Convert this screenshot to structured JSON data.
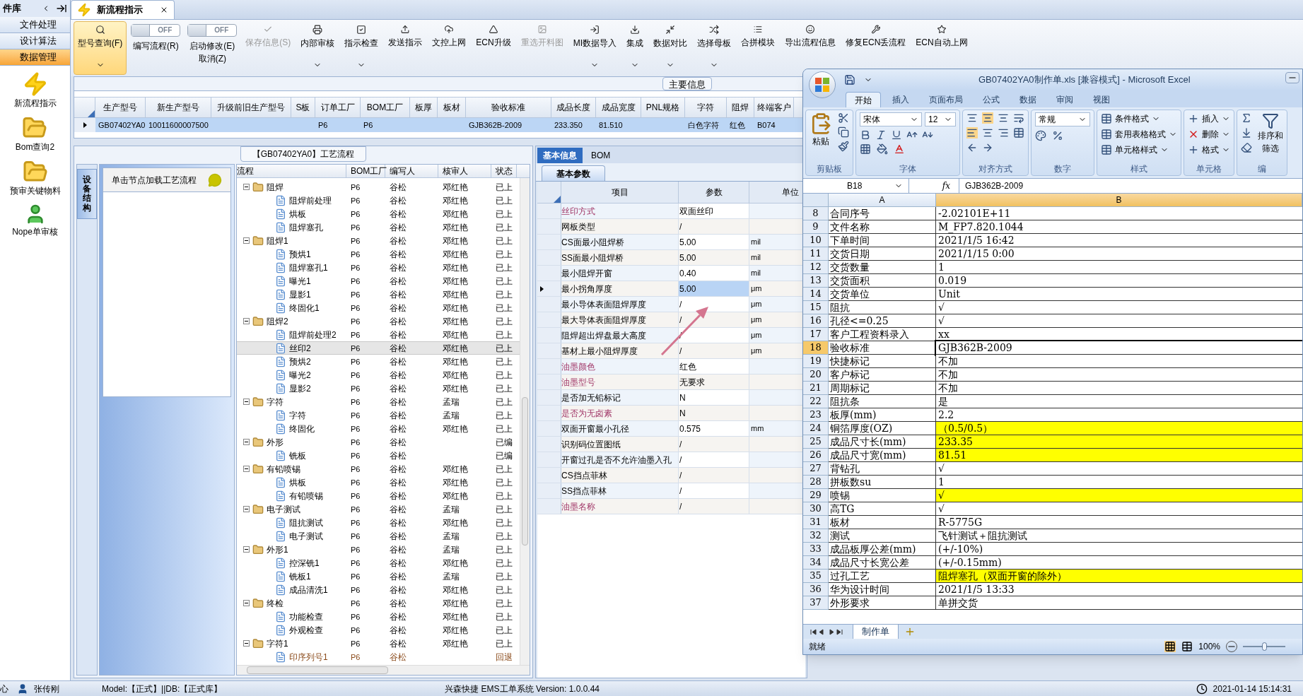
{
  "sidebar": {
    "title": "件库",
    "menu": [
      {
        "label": "文件处理",
        "selected": false
      },
      {
        "label": "设计算法",
        "selected": false
      },
      {
        "label": "数据管理",
        "selected": true
      }
    ],
    "shortcuts": [
      {
        "label": "新流程指示",
        "kind": "bolt"
      },
      {
        "label": "Bom查询2",
        "kind": "folder"
      },
      {
        "label": "预审关键物料",
        "kind": "folder"
      },
      {
        "label": "Nope单审核",
        "kind": "person"
      }
    ]
  },
  "tabs": [
    {
      "label": "新流程指示",
      "selected": true
    }
  ],
  "toolbar": [
    {
      "kind": "button",
      "label": "型号查询(F)",
      "selected": true,
      "disabled": false,
      "dropdown": true
    },
    {
      "kind": "toggle",
      "label": "编写流程(R)",
      "state_text": "OFF",
      "on": false
    },
    {
      "kind": "toggle",
      "label": "启动修改(E)",
      "label2": "取消(Z)",
      "state_text": "OFF",
      "on": false
    },
    {
      "kind": "button",
      "label": "保存信息(S)",
      "selected": false,
      "disabled": true,
      "dropdown": false
    },
    {
      "kind": "button",
      "label": "内部审核",
      "selected": false,
      "disabled": false,
      "dropdown": true
    },
    {
      "kind": "button",
      "label": "指示检查",
      "selected": false,
      "disabled": false,
      "dropdown": true
    },
    {
      "kind": "button",
      "label": "发送指示",
      "selected": false,
      "disabled": false,
      "dropdown": false
    },
    {
      "kind": "button",
      "label": "文控上网",
      "selected": false,
      "disabled": false,
      "dropdown": false
    },
    {
      "kind": "button",
      "label": "ECN升级",
      "selected": false,
      "disabled": false,
      "dropdown": false
    },
    {
      "kind": "button",
      "label": "重选开料图",
      "selected": false,
      "disabled": true,
      "dropdown": false
    },
    {
      "kind": "button",
      "label": "MI数据导入",
      "selected": false,
      "disabled": false,
      "dropdown": true
    },
    {
      "kind": "button",
      "label": "集成",
      "selected": false,
      "disabled": false,
      "dropdown": true
    },
    {
      "kind": "button",
      "label": "数据对比",
      "selected": false,
      "disabled": false,
      "dropdown": true
    },
    {
      "kind": "button",
      "label": "选择母板",
      "selected": false,
      "disabled": false,
      "dropdown": true
    },
    {
      "kind": "button",
      "label": "合拼模块",
      "selected": false,
      "disabled": false,
      "dropdown": false
    },
    {
      "kind": "button",
      "label": "导出流程信息",
      "selected": false,
      "disabled": false,
      "dropdown": false
    },
    {
      "kind": "button",
      "label": "修复ECN丢流程",
      "selected": false,
      "disabled": false,
      "dropdown": false
    },
    {
      "kind": "button",
      "label": "ECN自动上网",
      "selected": false,
      "disabled": false,
      "dropdown": false
    }
  ],
  "main_info": {
    "title": "主要信息",
    "columns": [
      "生产型号",
      "新生产型号",
      "升级前旧生产型号",
      "S板",
      "订单工厂",
      "BOM工厂",
      "板厚",
      "板材",
      "验收标准",
      "成品长度",
      "成品宽度",
      "PNL规格",
      "字符",
      "阻焊",
      "终端客户"
    ],
    "rows": [
      {
        "selected": true,
        "cells": [
          "GB07402YA0",
          "10011600007500",
          "",
          "",
          "P6",
          "P6",
          "",
          "",
          "GJB362B-2009",
          "233.350",
          "81.510",
          "",
          "白色字符",
          "红色",
          "B074"
        ]
      }
    ]
  },
  "process": {
    "title": "【GB07402YA0】工艺流程",
    "side_tab": "设备结构",
    "hint": "单击节点加载工艺流程",
    "columns": [
      "流程",
      "BOM工厂",
      "编写人",
      "核审人",
      "状态"
    ],
    "rows": [
      {
        "name": "阻焊",
        "bom": "P6",
        "writer": "谷松",
        "reviewer": "邓红艳",
        "status": "已上",
        "expanded": true,
        "selected": false,
        "returned": false,
        "children": [
          {
            "name": "阻焊前处理",
            "bom": "P6",
            "writer": "谷松",
            "reviewer": "邓红艳",
            "status": "已上",
            "selected": false,
            "returned": false
          },
          {
            "name": "烘板",
            "bom": "P6",
            "writer": "谷松",
            "reviewer": "邓红艳",
            "status": "已上",
            "selected": false,
            "returned": false
          },
          {
            "name": "阻焊塞孔",
            "bom": "P6",
            "writer": "谷松",
            "reviewer": "邓红艳",
            "status": "已上",
            "selected": false,
            "returned": false
          }
        ]
      },
      {
        "name": "阻焊1",
        "bom": "P6",
        "writer": "谷松",
        "reviewer": "邓红艳",
        "status": "已上",
        "expanded": true,
        "selected": false,
        "returned": false,
        "children": [
          {
            "name": "预烘1",
            "bom": "P6",
            "writer": "谷松",
            "reviewer": "邓红艳",
            "status": "已上",
            "selected": false,
            "returned": false
          },
          {
            "name": "阻焊塞孔1",
            "bom": "P6",
            "writer": "谷松",
            "reviewer": "邓红艳",
            "status": "已上",
            "selected": false,
            "returned": false
          },
          {
            "name": "曝光1",
            "bom": "P6",
            "writer": "谷松",
            "reviewer": "邓红艳",
            "status": "已上",
            "selected": false,
            "returned": false
          },
          {
            "name": "显影1",
            "bom": "P6",
            "writer": "谷松",
            "reviewer": "邓红艳",
            "status": "已上",
            "selected": false,
            "returned": false
          },
          {
            "name": "终固化1",
            "bom": "P6",
            "writer": "谷松",
            "reviewer": "邓红艳",
            "status": "已上",
            "selected": false,
            "returned": false
          }
        ]
      },
      {
        "name": "阻焊2",
        "bom": "P6",
        "writer": "谷松",
        "reviewer": "邓红艳",
        "status": "已上",
        "expanded": true,
        "selected": false,
        "returned": false,
        "children": [
          {
            "name": "阻焊前处理2",
            "bom": "P6",
            "writer": "谷松",
            "reviewer": "邓红艳",
            "status": "已上",
            "selected": false,
            "returned": false
          },
          {
            "name": "丝印2",
            "bom": "P6",
            "writer": "谷松",
            "reviewer": "邓红艳",
            "status": "已上",
            "selected": true,
            "returned": false
          },
          {
            "name": "预烘2",
            "bom": "P6",
            "writer": "谷松",
            "reviewer": "邓红艳",
            "status": "已上",
            "selected": false,
            "returned": false
          },
          {
            "name": "曝光2",
            "bom": "P6",
            "writer": "谷松",
            "reviewer": "邓红艳",
            "status": "已上",
            "selected": false,
            "returned": false
          },
          {
            "name": "显影2",
            "bom": "P6",
            "writer": "谷松",
            "reviewer": "邓红艳",
            "status": "已上",
            "selected": false,
            "returned": false
          }
        ]
      },
      {
        "name": "字符",
        "bom": "P6",
        "writer": "谷松",
        "reviewer": "孟瑞",
        "status": "已上",
        "expanded": true,
        "selected": false,
        "returned": false,
        "children": [
          {
            "name": "字符",
            "bom": "P6",
            "writer": "谷松",
            "reviewer": "孟瑞",
            "status": "已上",
            "selected": false,
            "returned": false
          },
          {
            "name": "终固化",
            "bom": "P6",
            "writer": "谷松",
            "reviewer": "邓红艳",
            "status": "已上",
            "selected": false,
            "returned": false
          }
        ]
      },
      {
        "name": "外形",
        "bom": "P6",
        "writer": "谷松",
        "status": "已编",
        "expanded": true,
        "selected": false,
        "returned": false,
        "children": [
          {
            "name": "铣板",
            "bom": "P6",
            "writer": "谷松",
            "status": "已编",
            "selected": false,
            "returned": false
          }
        ]
      },
      {
        "name": "有铅喷锡",
        "bom": "P6",
        "writer": "谷松",
        "reviewer": "邓红艳",
        "status": "已上",
        "expanded": true,
        "selected": false,
        "returned": false,
        "children": [
          {
            "name": "烘板",
            "bom": "P6",
            "writer": "谷松",
            "reviewer": "邓红艳",
            "status": "已上",
            "selected": false,
            "returned": false
          },
          {
            "name": "有铅喷锡",
            "bom": "P6",
            "writer": "谷松",
            "reviewer": "邓红艳",
            "status": "已上",
            "selected": false,
            "returned": false
          }
        ]
      },
      {
        "name": "电子测试",
        "bom": "P6",
        "writer": "谷松",
        "reviewer": "孟瑞",
        "status": "已上",
        "expanded": true,
        "selected": false,
        "returned": false,
        "children": [
          {
            "name": "阻抗测试",
            "bom": "P6",
            "writer": "谷松",
            "reviewer": "邓红艳",
            "status": "已上",
            "selected": false,
            "returned": false
          },
          {
            "name": "电子测试",
            "bom": "P6",
            "writer": "谷松",
            "reviewer": "孟瑞",
            "status": "已上",
            "selected": false,
            "returned": false
          }
        ]
      },
      {
        "name": "外形1",
        "bom": "P6",
        "writer": "谷松",
        "reviewer": "孟瑞",
        "status": "已上",
        "expanded": true,
        "selected": false,
        "returned": false,
        "children": [
          {
            "name": "控深铣1",
            "bom": "P6",
            "writer": "谷松",
            "reviewer": "邓红艳",
            "status": "已上",
            "selected": false,
            "returned": false
          },
          {
            "name": "铣板1",
            "bom": "P6",
            "writer": "谷松",
            "reviewer": "孟瑞",
            "status": "已上",
            "selected": false,
            "returned": false
          },
          {
            "name": "成品清洗1",
            "bom": "P6",
            "writer": "谷松",
            "reviewer": "邓红艳",
            "status": "已上",
            "selected": false,
            "returned": false
          }
        ]
      },
      {
        "name": "终检",
        "bom": "P6",
        "writer": "谷松",
        "reviewer": "邓红艳",
        "status": "已上",
        "expanded": true,
        "selected": false,
        "returned": false,
        "children": [
          {
            "name": "功能检查",
            "bom": "P6",
            "writer": "谷松",
            "reviewer": "邓红艳",
            "status": "已上",
            "selected": false,
            "returned": false
          },
          {
            "name": "外观检查",
            "bom": "P6",
            "writer": "谷松",
            "reviewer": "邓红艳",
            "status": "已上",
            "selected": false,
            "returned": false
          }
        ]
      },
      {
        "name": "字符1",
        "bom": "P6",
        "writer": "谷松",
        "reviewer": "邓红艳",
        "status": "已上",
        "expanded": true,
        "selected": false,
        "returned": false,
        "children": [
          {
            "name": "印序列号1",
            "bom": "P6",
            "writer": "谷松",
            "status": "回退",
            "selected": false,
            "returned": true
          }
        ]
      }
    ]
  },
  "params": {
    "tabs": [
      {
        "label": "基本信息",
        "selected": true
      },
      {
        "label": "BOM",
        "selected": false
      }
    ],
    "subtabs": [
      {
        "label": "基本参数",
        "selected": true
      }
    ],
    "columns": [
      "项目",
      "参数",
      "单位"
    ],
    "rows": [
      {
        "item": "丝印方式",
        "value": "双面丝印",
        "required": true,
        "selected": false
      },
      {
        "item": "网板类型",
        "value": "/",
        "required": false,
        "selected": false
      },
      {
        "item": "CS面最小阻焊桥",
        "value": "5.00",
        "unit": "mil",
        "required": false,
        "selected": false
      },
      {
        "item": "SS面最小阻焊桥",
        "value": "5.00",
        "unit": "mil",
        "required": false,
        "selected": false
      },
      {
        "item": "最小阻焊开窗",
        "value": "0.40",
        "unit": "mil",
        "required": false,
        "selected": false
      },
      {
        "item": "最小拐角厚度",
        "value": "5.00",
        "unit": "μm",
        "required": false,
        "selected": true
      },
      {
        "item": "最小导体表面阻焊厚度",
        "value": "/",
        "unit": "μm",
        "required": false,
        "selected": false
      },
      {
        "item": "最大导体表面阻焊厚度",
        "value": "/",
        "unit": "μm",
        "required": false,
        "selected": false
      },
      {
        "item": "阻焊超出焊盘最大高度",
        "value": "/",
        "unit": "μm",
        "required": false,
        "selected": false
      },
      {
        "item": "基材上最小阻焊厚度",
        "value": "/",
        "unit": "μm",
        "required": false,
        "selected": false
      },
      {
        "item": "油墨颜色",
        "value": "红色",
        "required": true,
        "selected": false
      },
      {
        "item": "油墨型号",
        "value": "无要求",
        "required": true,
        "selected": false
      },
      {
        "item": "是否加无铅标记",
        "value": "N",
        "required": false,
        "selected": false
      },
      {
        "item": "是否为无卤素",
        "value": "N",
        "required": true,
        "selected": false
      },
      {
        "item": "双面开窗最小孔径",
        "value": "0.575",
        "unit": "mm",
        "required": false,
        "selected": false
      },
      {
        "item": "识别码位置图纸",
        "value": "/",
        "required": false,
        "selected": false
      },
      {
        "item": "开窗过孔是否不允许油墨入孔",
        "value": "/",
        "required": false,
        "selected": false
      },
      {
        "item": "CS挡点菲林",
        "value": "/",
        "required": false,
        "selected": false
      },
      {
        "item": "SS挡点菲林",
        "value": "/",
        "required": false,
        "selected": false
      },
      {
        "item": "油墨名称",
        "value": "/",
        "required": true,
        "selected": false
      }
    ]
  },
  "excel": {
    "title": "GB07402YA0制作单.xls  [兼容模式] - Microsoft Excel",
    "tabs": [
      {
        "label": "开始",
        "selected": true
      },
      {
        "label": "插入",
        "selected": false
      },
      {
        "label": "页面布局",
        "selected": false
      },
      {
        "label": "公式",
        "selected": false
      },
      {
        "label": "数据",
        "selected": false
      },
      {
        "label": "审阅",
        "selected": false
      },
      {
        "label": "视图",
        "selected": false
      }
    ],
    "groups": [
      {
        "kind": "clipboard",
        "label": "剪贴板",
        "items": [
          "粘贴"
        ]
      },
      {
        "kind": "font",
        "label": "字体",
        "items": [
          "宋体",
          "12"
        ]
      },
      {
        "kind": "align",
        "label": "对齐方式"
      },
      {
        "kind": "number",
        "label": "数字",
        "items": [
          "常规"
        ]
      },
      {
        "kind": "styles",
        "label": "样式",
        "items": [
          "条件格式",
          "套用表格格式",
          "单元格样式"
        ]
      },
      {
        "kind": "cells",
        "label": "单元格",
        "items": [
          "插入",
          "删除",
          "格式"
        ]
      },
      {
        "kind": "edit",
        "label": "编",
        "items": [
          "排序和",
          "筛选"
        ]
      }
    ],
    "name_box": "B18",
    "fx_label": "fx",
    "formula": "GJB362B-2009",
    "columns": [
      {
        "label": "A",
        "selected": false
      },
      {
        "label": "B",
        "selected": true
      }
    ],
    "rows": [
      {
        "num": "8",
        "a": "合同序号",
        "b": "-2.02101E+11",
        "highlighted": false,
        "selected": false
      },
      {
        "num": "9",
        "a": "文件名称",
        "b": "M_FP7.820.1044",
        "highlighted": false,
        "selected": false
      },
      {
        "num": "10",
        "a": "下单时间",
        "b": "2021/1/5 16:42",
        "highlighted": false,
        "selected": false
      },
      {
        "num": "11",
        "a": "交货日期",
        "b": "2021/1/15 0:00",
        "highlighted": false,
        "selected": false
      },
      {
        "num": "12",
        "a": "交货数量",
        "b": "1",
        "highlighted": false,
        "selected": false
      },
      {
        "num": "13",
        "a": "交货面积",
        "b": "0.019",
        "highlighted": false,
        "selected": false
      },
      {
        "num": "14",
        "a": "交货单位",
        "b": "Unit",
        "highlighted": false,
        "selected": false
      },
      {
        "num": "15",
        "a": "阻抗",
        "b": "√",
        "highlighted": false,
        "selected": false
      },
      {
        "num": "16",
        "a": "孔径<=0.25",
        "b": "√",
        "highlighted": false,
        "selected": false
      },
      {
        "num": "17",
        "a": "客户工程资料录入",
        "b": "xx",
        "highlighted": false,
        "selected": false
      },
      {
        "num": "18",
        "a": "验收标准",
        "b": "GJB362B-2009",
        "highlighted": false,
        "selected": true
      },
      {
        "num": "19",
        "a": "快捷标记",
        "b": "不加",
        "highlighted": false,
        "selected": false
      },
      {
        "num": "20",
        "a": "客户标记",
        "b": "不加",
        "highlighted": false,
        "selected": false
      },
      {
        "num": "21",
        "a": "周期标记",
        "b": "不加",
        "highlighted": false,
        "selected": false
      },
      {
        "num": "22",
        "a": "阻抗条",
        "b": "是",
        "highlighted": false,
        "selected": false
      },
      {
        "num": "23",
        "a": "板厚(mm)",
        "b": "2.2",
        "highlighted": false,
        "selected": false
      },
      {
        "num": "24",
        "a": "铜箔厚度(OZ)",
        "b": "（0.5/0.5）",
        "highlighted": true,
        "selected": false
      },
      {
        "num": "25",
        "a": "成品尺寸长(mm)",
        "b": "233.35",
        "highlighted": true,
        "selected": false
      },
      {
        "num": "26",
        "a": "成品尺寸宽(mm)",
        "b": "81.51",
        "highlighted": true,
        "selected": false
      },
      {
        "num": "27",
        "a": "背钻孔",
        "b": "√",
        "highlighted": false,
        "selected": false
      },
      {
        "num": "28",
        "a": "拼板数su",
        "b": "1",
        "highlighted": false,
        "selected": false
      },
      {
        "num": "29",
        "a": "喷锡",
        "b": "√",
        "highlighted": true,
        "selected": false
      },
      {
        "num": "30",
        "a": "高TG",
        "b": "√",
        "highlighted": false,
        "selected": false
      },
      {
        "num": "31",
        "a": "板材",
        "b": "R-5775G",
        "highlighted": false,
        "selected": false
      },
      {
        "num": "32",
        "a": "测试",
        "b": "飞针测试＋阻抗测试",
        "highlighted": false,
        "selected": false
      },
      {
        "num": "33",
        "a": "成品板厚公差(mm)",
        "b": "(+/-10%)",
        "highlighted": false,
        "selected": false
      },
      {
        "num": "34",
        "a": "成品尺寸长宽公差",
        "b": "(+/-0.15mm)",
        "highlighted": false,
        "selected": false
      },
      {
        "num": "35",
        "a": "过孔工艺",
        "b": "阻焊塞孔（双面开窗的除外）",
        "highlighted": true,
        "selected": false
      },
      {
        "num": "36",
        "a": "华为设计时间",
        "b": "2021/1/5 13:33",
        "highlighted": false,
        "selected": false
      },
      {
        "num": "37",
        "a": "外形要求",
        "b": "单拼交货",
        "highlighted": false,
        "selected": false
      }
    ],
    "sheets": [
      {
        "label": "制作单",
        "selected": true
      }
    ],
    "status": "就绪",
    "zoom": "100%",
    "zoom_slider": {
      "level": 0.5
    }
  },
  "status_bar": {
    "left": "心",
    "user": "张传刚",
    "model": "Model:【正式】||DB:【正式库】",
    "system": "兴森快捷 EMS工单系统 Version: 1.0.0.44",
    "time": "2021-01-14 15:14:31"
  }
}
